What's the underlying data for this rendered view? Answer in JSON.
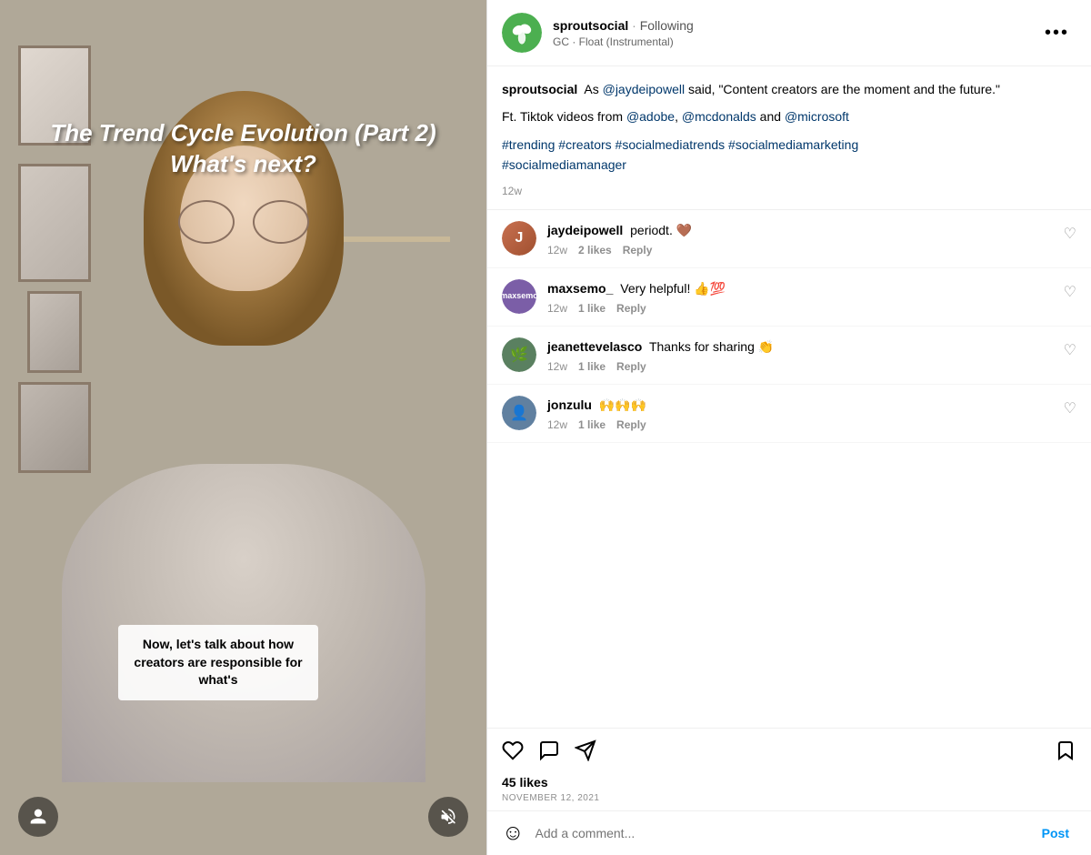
{
  "video": {
    "title_line1": "The Trend Cycle Evolution (Part 2)",
    "title_line2": "What's next?",
    "caption": "Now, let's talk about how creators are responsible for what's"
  },
  "header": {
    "username": "sproutsocial",
    "following": "Following",
    "dot": "·",
    "subtitle": "GC · Float (Instrumental)",
    "more_icon": "•••"
  },
  "post": {
    "username": "sproutsocial",
    "body_text": "As @jaydeipowell said, \"Content creators are the moment and the future.\"",
    "ft_text": "Ft. Tiktok videos from",
    "mentions": [
      "@adobe",
      "@mcdonalds",
      "@microsoft"
    ],
    "hashtags": "#trending #creators #socialmediatrends #socialmediamarketing #socialmediamanager",
    "time": "12w"
  },
  "comments": [
    {
      "author": "jaydeipowell",
      "text": "periodt. 🤎",
      "time": "12w",
      "likes": "2 likes",
      "reply_label": "Reply"
    },
    {
      "author": "maxsemo_",
      "text": "Very helpful! 👍💯",
      "time": "12w",
      "likes": "1 like",
      "reply_label": "Reply"
    },
    {
      "author": "jeanettevelasco",
      "text": "Thanks for sharing 👏",
      "time": "12w",
      "likes": "1 like",
      "reply_label": "Reply"
    },
    {
      "author": "jonzulu",
      "text": "🙌🙌🙌",
      "time": "12w",
      "likes": "1 like",
      "reply_label": "Reply"
    }
  ],
  "actions": {
    "likes_count": "45 likes",
    "post_date": "NOVEMBER 12, 2021",
    "post_btn": "Post",
    "comment_placeholder": "Add a comment..."
  }
}
